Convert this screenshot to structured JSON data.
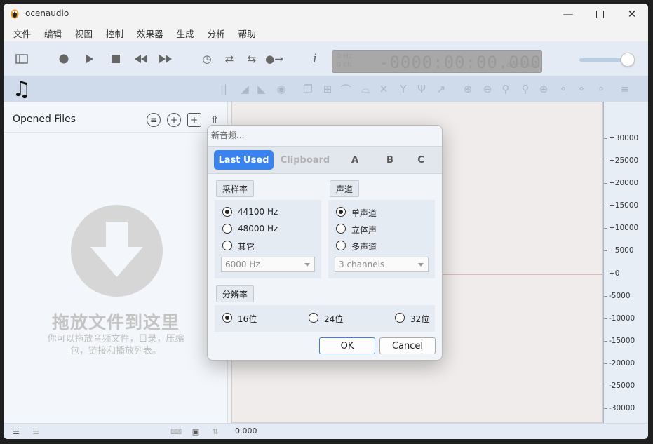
{
  "window": {
    "title": "ocenaudio"
  },
  "menu": [
    "文件",
    "编辑",
    "视图",
    "控制",
    "效果器",
    "生成",
    "分析",
    "帮助"
  ],
  "lcd": {
    "hz_label": "0 Hz",
    "ch_label": "0 ch",
    "time": "-0000:00:00.000",
    "format": "decimal"
  },
  "left_panel": {
    "title": "Opened Files",
    "drop_title": "拖放文件到这里",
    "drop_subtitle": "你可以拖放音频文件，目录，压缩包，链接和播放列表。"
  },
  "ruler": {
    "ticks": [
      "+30000",
      "+25000",
      "+20000",
      "+15000",
      "+10000",
      "+5000",
      "+0",
      "-5000",
      "-10000",
      "-15000",
      "-20000",
      "-25000",
      "-30000"
    ]
  },
  "status": {
    "time": "0.000"
  },
  "dialog": {
    "title": "新音频...",
    "tabs": [
      "Last Used",
      "Clipboard",
      "A",
      "B",
      "C"
    ],
    "active_tab": "Last Used",
    "sample_rate": {
      "label": "采样率",
      "options": [
        "44100 Hz",
        "48000 Hz",
        "其它"
      ],
      "selected": "44100 Hz",
      "custom_value": "6000 Hz"
    },
    "channels": {
      "label": "声道",
      "options": [
        "单声道",
        "立体声",
        "多声道"
      ],
      "selected": "单声道",
      "custom_value": "3 channels"
    },
    "resolution": {
      "label": "分辨率",
      "options": [
        "16位",
        "24位",
        "32位"
      ],
      "selected": "16位"
    },
    "ok_label": "OK",
    "cancel_label": "Cancel"
  },
  "colors": {
    "accent": "#3a82f0",
    "toolbar_bg": "#e4ebf4",
    "panel_bg": "#f3f6fa"
  }
}
